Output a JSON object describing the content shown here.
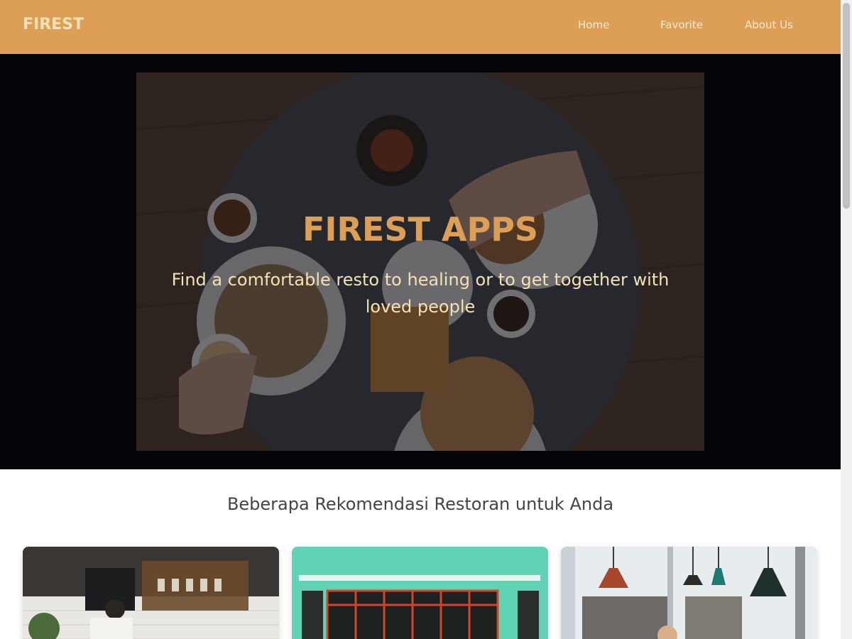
{
  "header": {
    "brand": "FIREST",
    "nav": [
      "Home",
      "Favorite",
      "About Us"
    ]
  },
  "hero": {
    "title": "FIREST APPS",
    "subtitle": "Find a comfortable resto to healing or to get together with loved people"
  },
  "section": {
    "title": "Beberapa Rekomendasi Restoran untuk Anda"
  },
  "colors": {
    "header_bg": "#dd9f56",
    "brand_text": "#f4e1b6",
    "hero_title": "#dd9f56",
    "hero_subtitle": "#f4e1b6",
    "hero_band": "#04040a"
  }
}
